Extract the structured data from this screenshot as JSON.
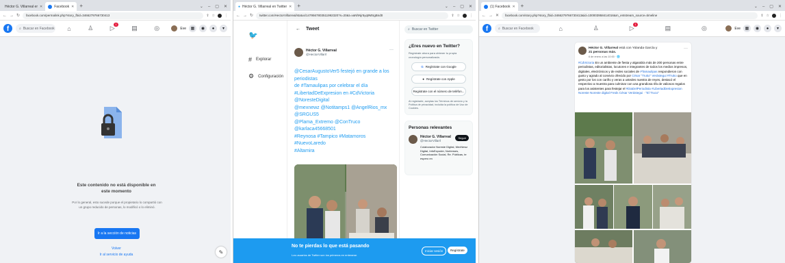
{
  "panel1": {
    "tabs": [
      {
        "title": "Héctor G. Villarreal en Twitter: \"@",
        "active": false
      },
      {
        "title": "Facebook",
        "active": true
      }
    ],
    "new_tab": "+",
    "window_controls": [
      "⌄",
      "–",
      "▢",
      "✕"
    ],
    "url": "facebook.com/permalink.php?story_fbid=3466279766730413",
    "search_placeholder": "Buscar en Facebook",
    "notif_count": "1",
    "user": "Eve",
    "unavailable_title": "Este contenido no está disponible en este momento",
    "unavailable_body": "Por lo general, esto sucede porque el propietario lo compartió con un grupo reducido de personas, lo modificó o lo eliminó. Ir a la sección de noticias",
    "unavailable_body_short": "Por lo general, esto sucede porque el propietario lo compartió con un grupo reducido de personas, lo modificó o lo eliminó.",
    "news_button": "Ir a la sección de noticias",
    "back_link": "Volver",
    "help_link": "Ir al servicio de ayuda"
  },
  "panel2": {
    "tabs": [
      {
        "title": "Héctor G. Villarreal en Twitter",
        "active": true
      },
      {
        "title": "+",
        "active": false
      }
    ],
    "window_controls": [
      "⌄",
      "–",
      "▢",
      "✕"
    ],
    "url": "twitter.com/HectorVillarreal/status/1479567803511992320?s=20&t=vaNhNjr5yq9MSgBnd0",
    "nav": [
      {
        "icon": "#",
        "label": "Explorar"
      },
      {
        "icon": "⚙",
        "label": "Configuración"
      }
    ],
    "header_title": "Tweet",
    "tweet_name": "Héctor G. Villarreal",
    "tweet_handle": "@HectorVillarrl",
    "tweet_lines": [
      "@CesarAugustoVer5 festejó en grande a los periodistas",
      "de #Tamaulipas por celebrar el día",
      "#LibertadDeExpresion en #CdVictoria @NoresteDigital",
      "@mexnewz @Notitamps1 @AngelRios_mx @SRGUS5",
      "@Plama_Extremo @ConTruco @karlaca45668501",
      "#Reynosa #Tampico #Matamoros #NuevoLaredo",
      "#Altamira"
    ],
    "search_placeholder": "Buscar en Twitter",
    "new_title": "¿Eres nuevo en Twitter?",
    "new_sub": "Regístrate ahora para obtener tu propia cronología personalizada.",
    "google_btn": "Regístrate con Google",
    "apple_btn": "Regístrate con Apple",
    "phone_btn": "Registrate con el número de teléfon...",
    "legal": "Al registrarte, aceptas los Términos de servicio y la Política de privacidad, incluida la política de Uso de Cookies.",
    "relevant_title": "Personas relevantes",
    "rel_name": "Héctor G. Villarreal",
    "rel_handle": "@HectorVillarrl",
    "follow_btn": "Seguir",
    "rel_bio": "Colaborador Noreste Digital, MexNewz Digital, InfoExpoder, Nortenses, Comunicación Social, Re. Públicas, te espero en",
    "bottom_title": "No te pierdas lo que está pasando",
    "bottom_sub": "Los usuarios de Twitter son los primeros en enterarse.",
    "login_btn": "Iniciar sesión",
    "register_btn": "Regístrate"
  },
  "panel3": {
    "tabs": [
      {
        "title": "(1) Facebook",
        "active": true
      }
    ],
    "new_tab": "+",
    "window_controls": [
      "⌄",
      "–",
      "▢",
      "✕"
    ],
    "url": "facebook.com/story.php?story_fbid=3466279766730413&id=100003958414016&m_entstream_source=timeline",
    "search_placeholder": "Buscar en Facebook",
    "notif_count": "1",
    "user": "Eve",
    "post_author": "Héctor G. Villarreal",
    "post_with": "está con Yolanda García y",
    "post_others": "21 personas más.",
    "post_time": "6 de enero a las 10:00 · 🌐",
    "post_text_parts": [
      {
        "t": "#CdVictoria",
        "h": true
      },
      {
        "t": " En un ambiente de fiesta y algarabía más de 200 personas entre periodistas, editorialistas, locutores e integrantes de todos los medios impresos, digitales, electrónicos y de redes sociales de ",
        "h": false
      },
      {
        "t": "#Tamaulipas",
        "h": true
      },
      {
        "t": " respondieron con gusto y agrado al convivio ofrecido por ",
        "h": false
      },
      {
        "t": "César \"Truko\" Verástegui",
        "h": true
      },
      {
        "t": " ",
        "h": false
      },
      {
        "t": "#Truko",
        "h": true
      },
      {
        "t": " que en gesto por los con cariño y veras a ustedes nuestra de reyes, destacó el respectivo a muestra para culminar con una grandiosa rifa de valiosos regalos para los asistentes para festejar el ",
        "h": false
      },
      {
        "t": "#DiaDelPeriodista #LibertadDeExpresion Noreste Noreste digital Freds César Verástegui · \"El Truco\"",
        "h": true
      }
    ]
  },
  "colors": {
    "fb_blue": "#1877f2",
    "tw_blue": "#1d9bf0",
    "fb_bg": "#f0f2f5"
  }
}
